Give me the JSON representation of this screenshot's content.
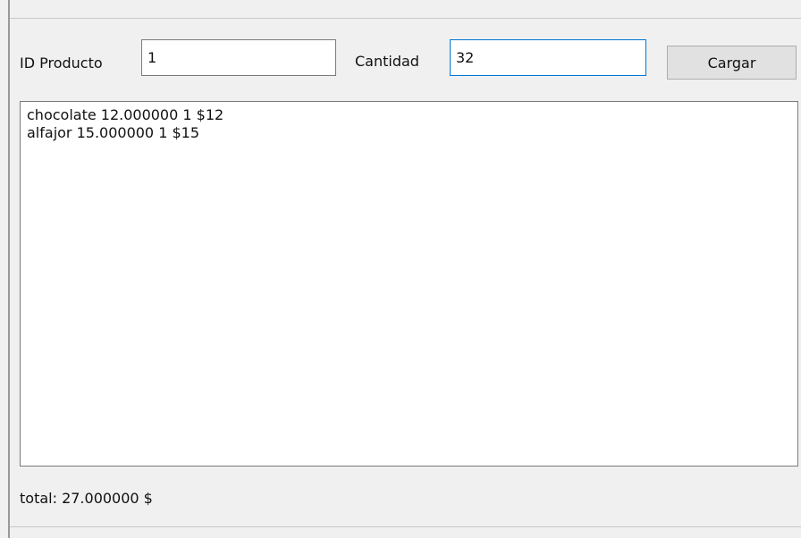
{
  "form": {
    "id_label": "ID Producto",
    "id_value": "1",
    "cantidad_label": "Cantidad",
    "cantidad_value": "32",
    "button_label": "Cargar"
  },
  "output": {
    "lines": [
      "chocolate 12.000000 1 $12",
      "alfajor 15.000000 1 $15"
    ]
  },
  "summary": {
    "total": "total: 27.000000 $"
  },
  "colors": {
    "window_bg": "#f0f0f0",
    "focus_border": "#0078d7"
  }
}
